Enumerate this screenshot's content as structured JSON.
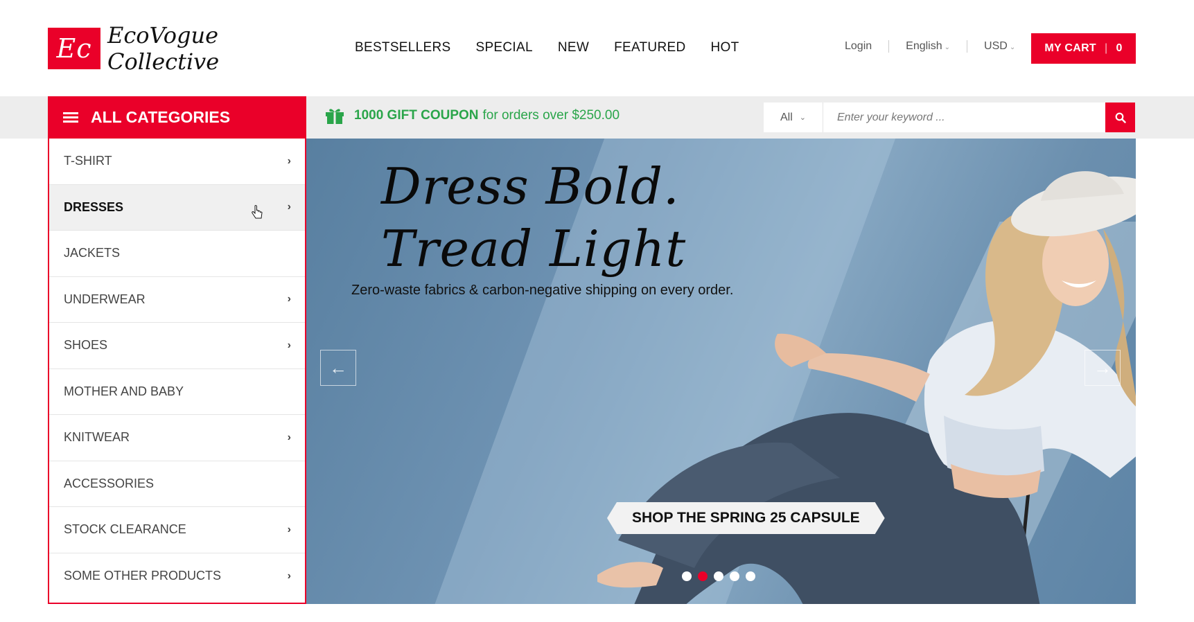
{
  "brand": {
    "mark": "Ec",
    "name_line1": "EcoVogue",
    "name_line2": "Collective",
    "accent_color": "#ea0029"
  },
  "nav": {
    "items": [
      "BESTSELLERS",
      "SPECIAL",
      "NEW",
      "FEATURED",
      "HOT"
    ]
  },
  "top_links": {
    "login": "Login",
    "language": "English",
    "currency": "USD"
  },
  "cart": {
    "label": "MY CART",
    "count": "0"
  },
  "categories_bar": {
    "title": "ALL CATEGORIES"
  },
  "coupon": {
    "highlight": "1000 GIFT COUPON",
    "text": "for orders over $250.00",
    "color": "#2aa54a"
  },
  "search": {
    "category": "All",
    "placeholder": "Enter your keyword ..."
  },
  "sidebar": {
    "items": [
      {
        "label": "T-SHIRT",
        "has_sub": true
      },
      {
        "label": "DRESSES",
        "has_sub": true,
        "active": true
      },
      {
        "label": "JACKETS",
        "has_sub": false
      },
      {
        "label": "UNDERWEAR",
        "has_sub": true
      },
      {
        "label": "SHOES",
        "has_sub": true
      },
      {
        "label": "MOTHER AND BABY",
        "has_sub": false
      },
      {
        "label": "KNITWEAR",
        "has_sub": true
      },
      {
        "label": "ACCESSORIES",
        "has_sub": false
      },
      {
        "label": "STOCK CLEARANCE",
        "has_sub": true
      },
      {
        "label": "SOME OTHER PRODUCTS",
        "has_sub": true
      }
    ]
  },
  "banner": {
    "headline_line1": "Dress Bold.",
    "headline_line2": "Tread Light",
    "subline": "Zero-waste fabrics & carbon-negative shipping on every order.",
    "cta": "SHOP THE SPRING 25 CAPSULE",
    "slides_total": 5,
    "active_slide": 2
  }
}
